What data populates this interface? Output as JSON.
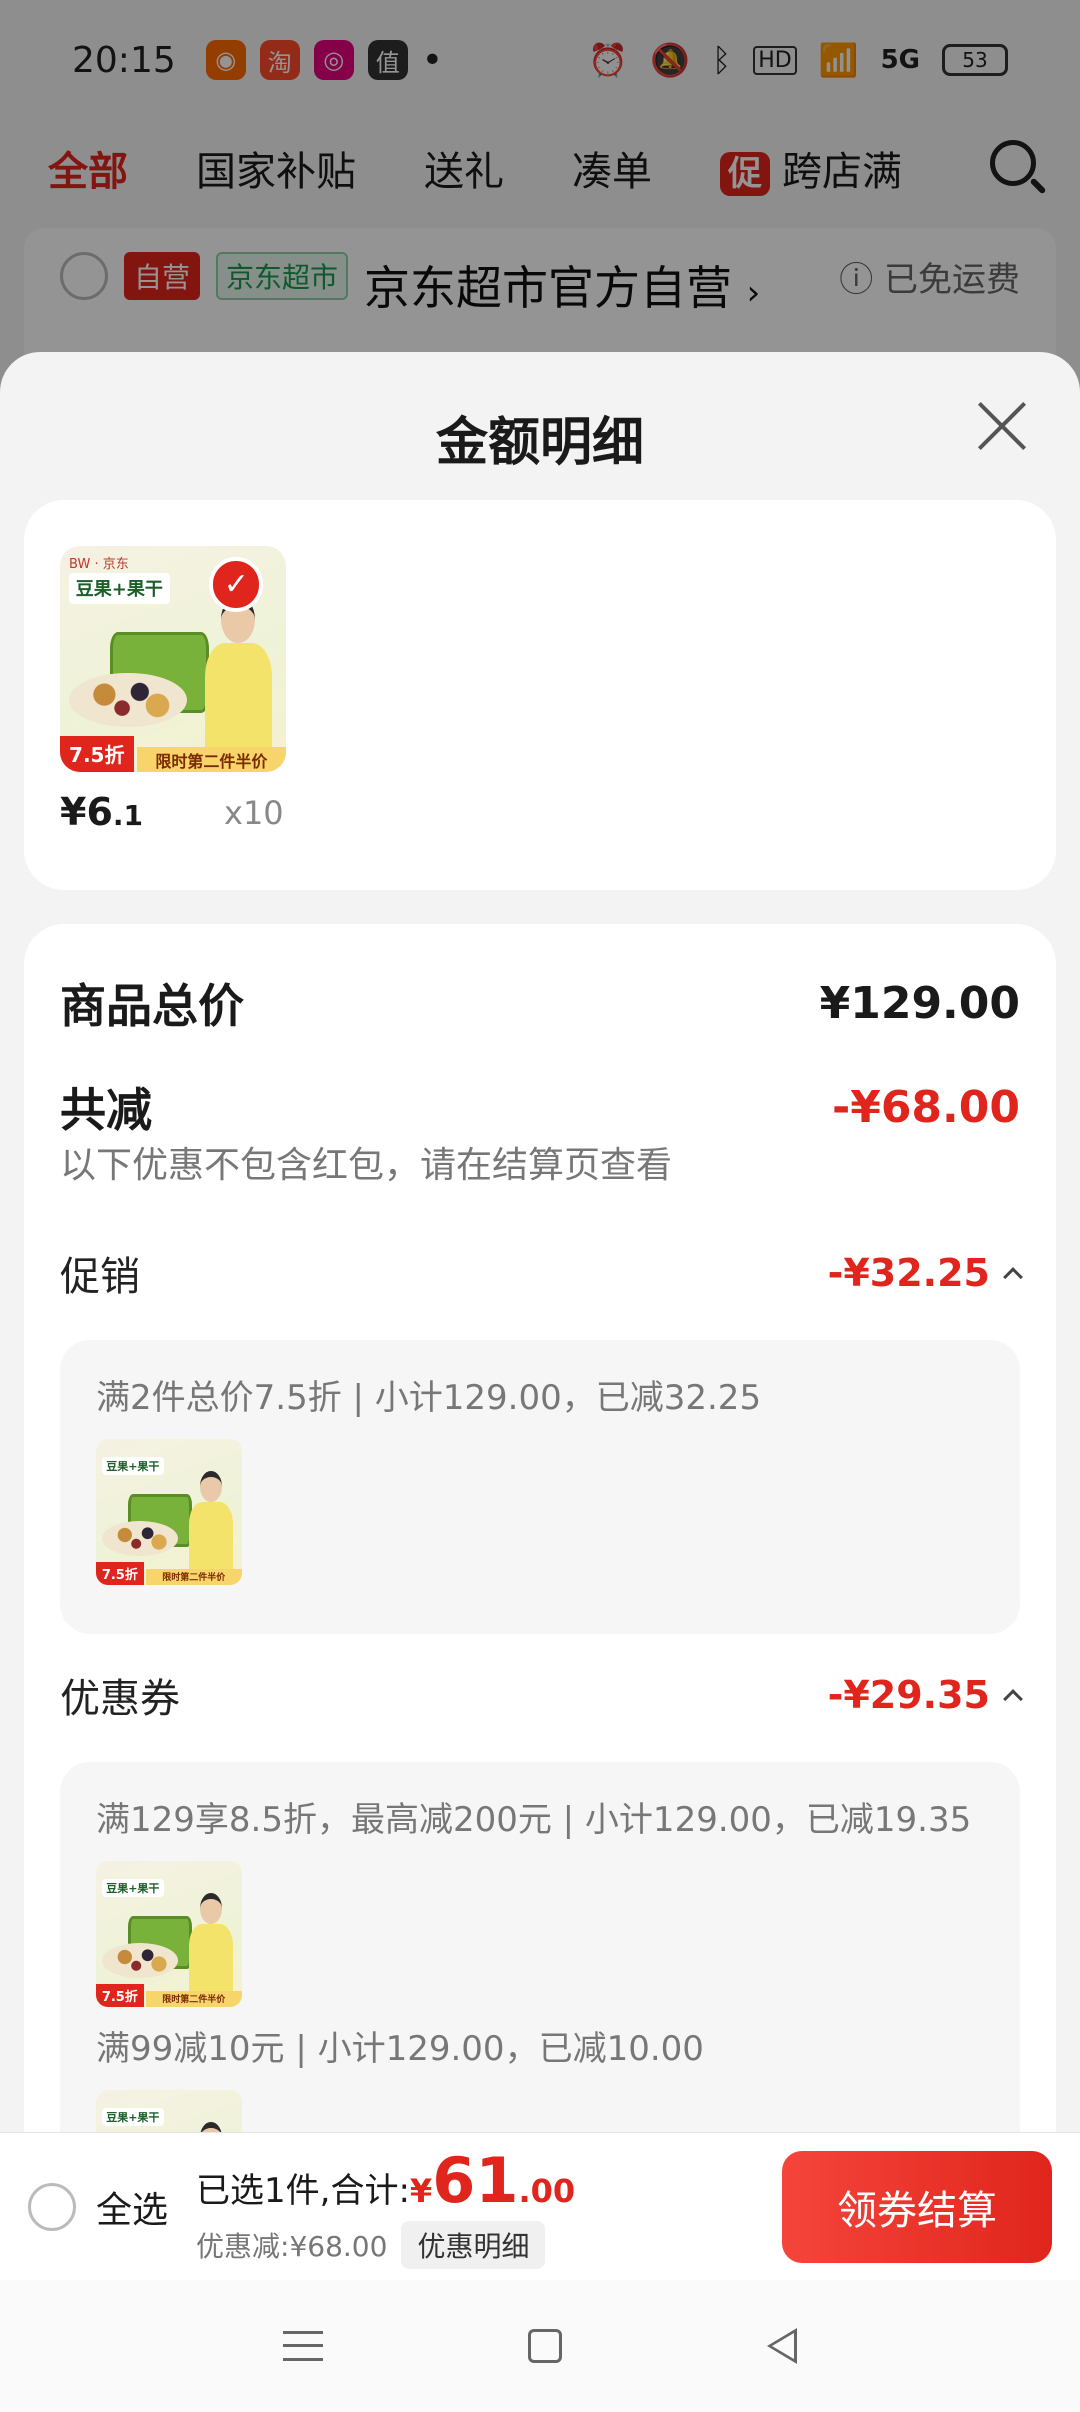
{
  "status_bar": {
    "time": "20:15",
    "signal_label": "5G",
    "hd_label": "HD",
    "battery": "53",
    "dot": "•"
  },
  "top_tabs": {
    "items": [
      "全部",
      "国家补贴",
      "送礼",
      "凑单"
    ],
    "promo_tag": "促",
    "promo_label": "跨店满"
  },
  "store": {
    "tag_self": "自营",
    "tag_market": "京东超市",
    "name": "京东超市官方自营",
    "name_arrow": "›",
    "shipping": "ⓘ 已免运费"
  },
  "sheet": {
    "title": "金额明细"
  },
  "product": {
    "brand": "BW · 京东",
    "title": "豆果+果干",
    "discount_badge": "7.5折",
    "half_price_banner": "限时第二件半价",
    "price_symbol": "¥",
    "price_int": "6",
    "price_dec": ".1",
    "quantity": "x10"
  },
  "summary": {
    "total_label": "商品总价",
    "total_value": "¥129.00",
    "reduce_label": "共减",
    "reduce_value": "-¥68.00",
    "note": "以下优惠不包含红包，请在结算页查看"
  },
  "promotion": {
    "label": "促销",
    "value": "-¥32.25",
    "rule": "满2件总价7.5折 | 小计129.00，已减32.25"
  },
  "coupon": {
    "label": "优惠券",
    "value": "-¥29.35",
    "rule_1": "满129享8.5折，最高减200元 | 小计129.00，已减19.35",
    "rule_2": "满99减10元 | 小计129.00，已减10.00"
  },
  "bottom_bar": {
    "select_all": "全选",
    "selected_text": "已选1件,合计:",
    "total_symbol": "¥",
    "total_int": "61",
    "total_dec": ".00",
    "discount_text": "优惠减:¥68.00",
    "detail_chip": "优惠明细",
    "checkout": "领券结算"
  },
  "colors": {
    "accent_red": "#e0251c",
    "tag_green": "#1a9b4e"
  }
}
